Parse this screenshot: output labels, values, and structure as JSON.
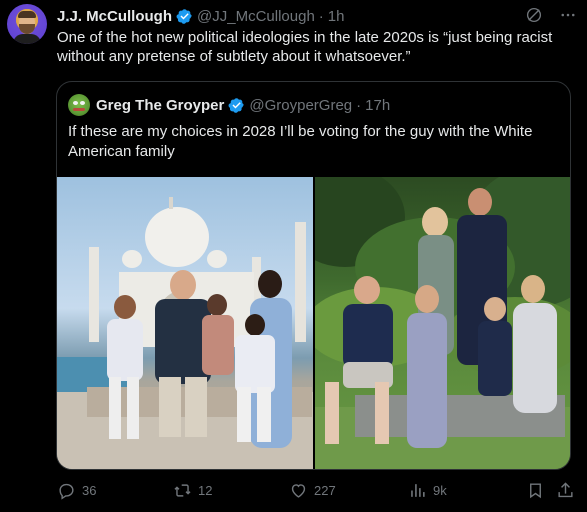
{
  "tweet": {
    "display_name": "J.J. McCullough",
    "handle": "@JJ_McCullough",
    "separator": "·",
    "time": "1h",
    "text": "One of the hot new political ideologies in the late 2020s is “just being racist without any pretense of subtlety about it whatsoever.”"
  },
  "quote": {
    "display_name": "Greg The Groyper",
    "handle": "@GroyperGreg",
    "separator": "·",
    "time": "17h",
    "text": "If these are my choices in 2028 I’ll be voting for the guy with the White American family"
  },
  "actions": {
    "replies": "36",
    "retweets": "12",
    "likes": "227",
    "views": "9k"
  },
  "colors": {
    "background": "#000000",
    "text": "#e7e9ea",
    "muted": "#71767b",
    "border": "#2f3336",
    "verified": "#1d9bf0"
  },
  "icons": [
    "grok-icon",
    "more-icon",
    "verified-badge-icon",
    "reply-icon",
    "retweet-icon",
    "like-icon",
    "views-icon",
    "bookmark-icon",
    "share-icon"
  ]
}
